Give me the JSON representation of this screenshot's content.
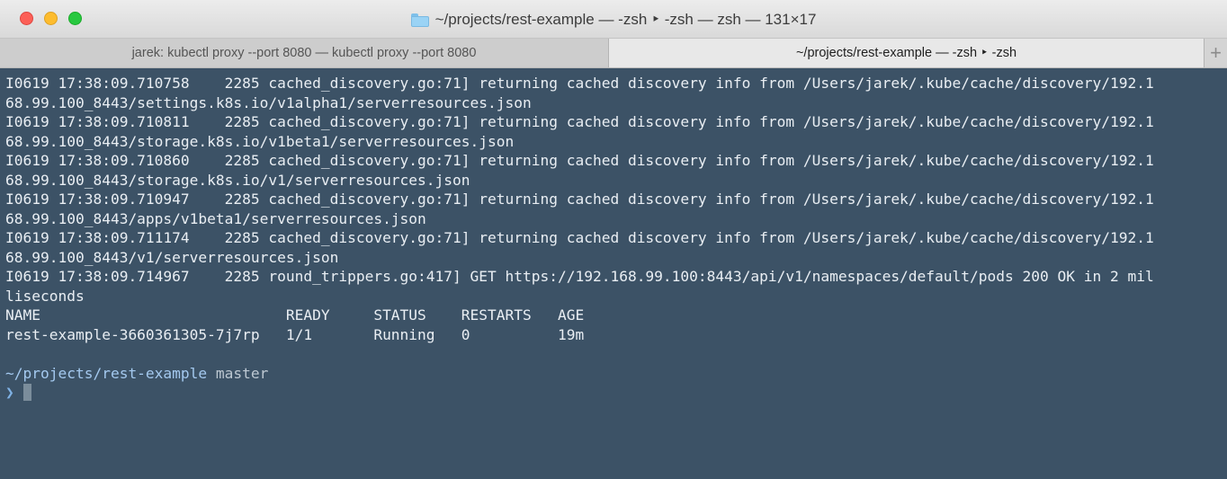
{
  "window": {
    "title": "~/projects/rest-example — -zsh ‣ -zsh — zsh — 131×17",
    "icon": "folder-icon",
    "colors": {
      "background": "#3c5266",
      "foreground": "#e9eef3",
      "prompt_path": "#a4c9ef",
      "close": "#fc5f57",
      "minimize": "#fdbc2e",
      "zoom": "#28c840"
    }
  },
  "tabs": [
    {
      "label": "jarek: kubectl proxy --port 8080 — kubectl proxy --port 8080",
      "active": false
    },
    {
      "label": "~/projects/rest-example — -zsh ‣ -zsh",
      "active": true
    }
  ],
  "new_tab_label": "+",
  "terminal": {
    "lines": [
      "I0619 17:38:09.710758    2285 cached_discovery.go:71] returning cached discovery info from /Users/jarek/.kube/cache/discovery/192.1",
      "68.99.100_8443/settings.k8s.io/v1alpha1/serverresources.json",
      "I0619 17:38:09.710811    2285 cached_discovery.go:71] returning cached discovery info from /Users/jarek/.kube/cache/discovery/192.1",
      "68.99.100_8443/storage.k8s.io/v1beta1/serverresources.json",
      "I0619 17:38:09.710860    2285 cached_discovery.go:71] returning cached discovery info from /Users/jarek/.kube/cache/discovery/192.1",
      "68.99.100_8443/storage.k8s.io/v1/serverresources.json",
      "I0619 17:38:09.710947    2285 cached_discovery.go:71] returning cached discovery info from /Users/jarek/.kube/cache/discovery/192.1",
      "68.99.100_8443/apps/v1beta1/serverresources.json",
      "I0619 17:38:09.711174    2285 cached_discovery.go:71] returning cached discovery info from /Users/jarek/.kube/cache/discovery/192.1",
      "68.99.100_8443/v1/serverresources.json",
      "I0619 17:38:09.714967    2285 round_trippers.go:417] GET https://192.168.99.100:8443/api/v1/namespaces/default/pods 200 OK in 2 mil",
      "liseconds",
      "NAME                            READY     STATUS    RESTARTS   AGE",
      "rest-example-3660361305-7j7rp   1/1       Running   0          19m",
      ""
    ],
    "prompt": {
      "path": "~/projects/rest-example",
      "branch": " master",
      "arrow": "❯"
    }
  }
}
